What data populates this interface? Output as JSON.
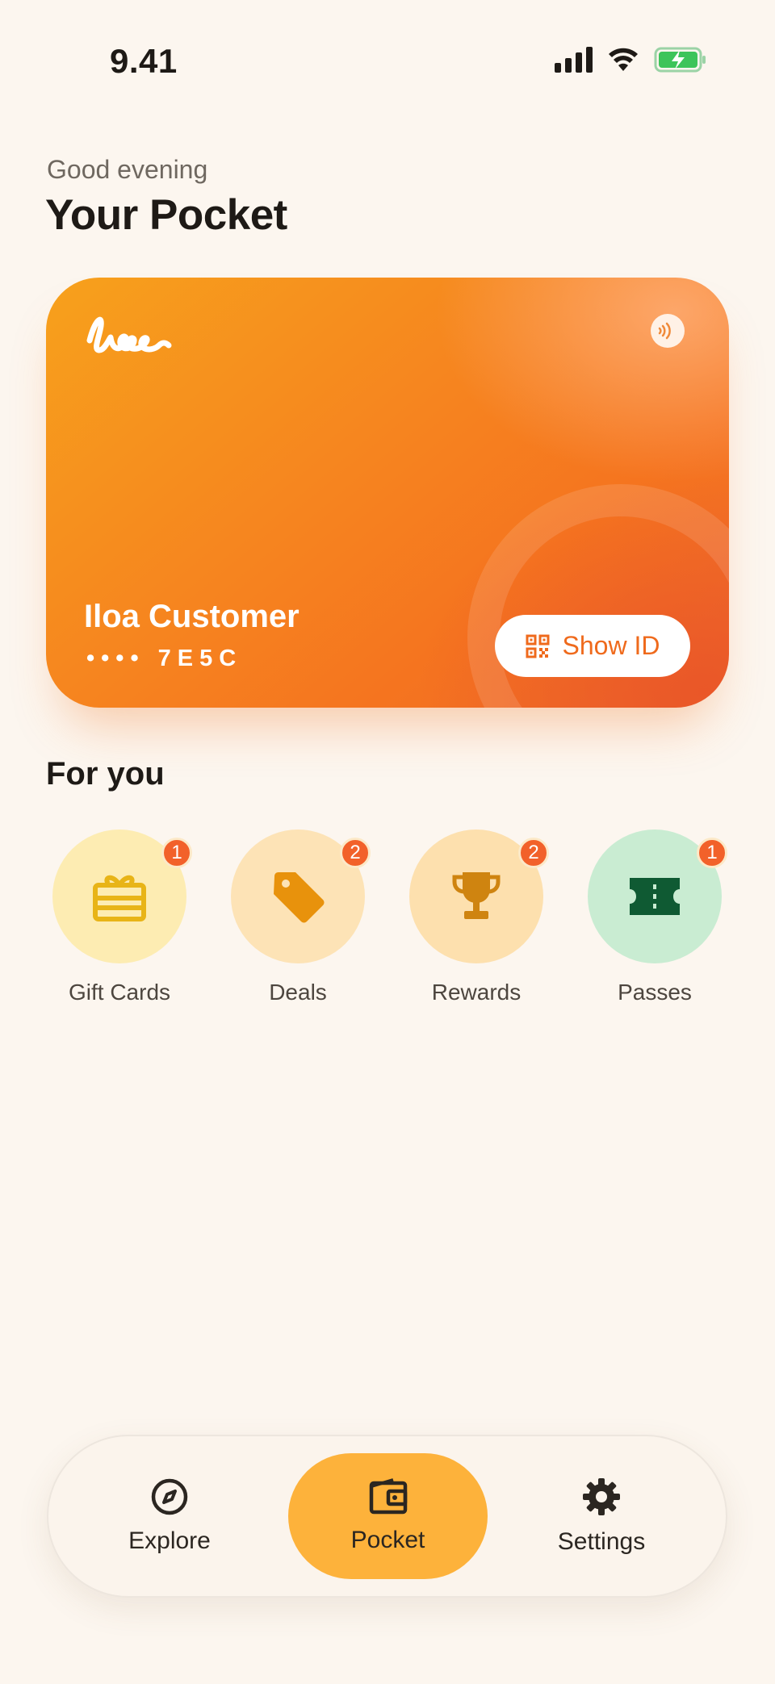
{
  "status_bar": {
    "time": "9.41"
  },
  "header": {
    "greeting": "Good evening",
    "title": "Your Pocket"
  },
  "card": {
    "logo_text": "iloo",
    "holder_name": "Iloa Customer",
    "masked_number": "•••• 7E5C",
    "show_id_label": "Show ID",
    "accent_color": "#ef6a1c"
  },
  "for_you": {
    "title": "For you",
    "items": [
      {
        "label": "Gift Cards",
        "badge": "1",
        "icon": "gift-card-icon",
        "bg": "#fdecb2",
        "fg": "#e8b417"
      },
      {
        "label": "Deals",
        "badge": "2",
        "icon": "tag-icon",
        "bg": "#fde3b6",
        "fg": "#e8920c"
      },
      {
        "label": "Rewards",
        "badge": "2",
        "icon": "trophy-icon",
        "bg": "#fde0ae",
        "fg": "#cf8410"
      },
      {
        "label": "Passes",
        "badge": "1",
        "icon": "ticket-icon",
        "bg": "#c9ecd2",
        "fg": "#0f5a33"
      }
    ]
  },
  "bottom_nav": {
    "items": [
      {
        "label": "Explore",
        "icon": "compass-icon"
      },
      {
        "label": "Pocket",
        "icon": "wallet-icon",
        "active": true
      },
      {
        "label": "Settings",
        "icon": "gear-icon"
      }
    ],
    "active_color": "#fdb23b"
  }
}
